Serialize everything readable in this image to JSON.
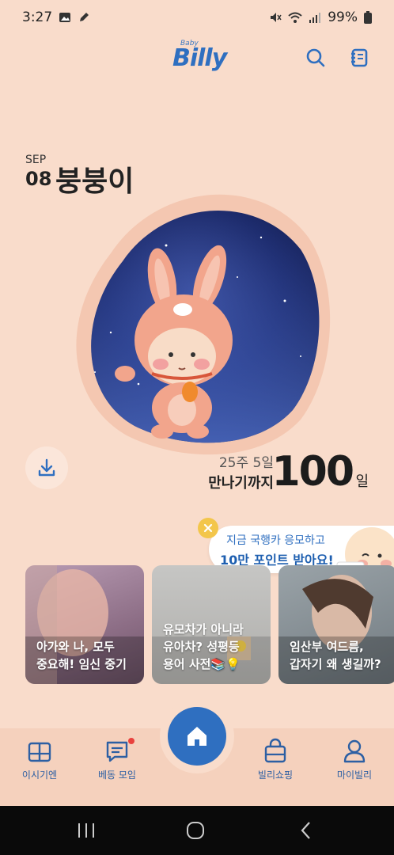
{
  "status": {
    "time": "3:27",
    "battery": "99%"
  },
  "header": {
    "logo_small": "Baby",
    "logo": "Billy",
    "icons": [
      "search-icon",
      "diary-icon"
    ]
  },
  "date": {
    "month": "SEP",
    "day": "08",
    "baby_name": "붕붕이"
  },
  "countdown": {
    "weeks": "25주 5일",
    "until": "만나기까지",
    "days": "100",
    "unit": "일"
  },
  "promo": {
    "line1": "지금 국행카 응모하고",
    "line2": "10만 포인트 받아요!"
  },
  "cards": [
    {
      "title": "아가와 나, 모두\n중요해! 임신 중기"
    },
    {
      "title": "유모차가 아니라\n유아차? 성평등\n용어 사전📚💡"
    },
    {
      "title": "임산부 여드름,\n갑자기 왜 생길까?"
    }
  ],
  "nav": {
    "items": [
      {
        "label": "이시기엔",
        "icon": "book-icon"
      },
      {
        "label": "베동 모임",
        "icon": "chat-icon"
      },
      {
        "label": "빌리쇼핑",
        "icon": "shopping-bag-icon"
      },
      {
        "label": "마이빌리",
        "icon": "profile-icon"
      }
    ],
    "home_icon": "home-icon"
  },
  "colors": {
    "background": "#f9dccb",
    "brand": "#2f6fc0",
    "promo_badge": "#f3c64b"
  }
}
